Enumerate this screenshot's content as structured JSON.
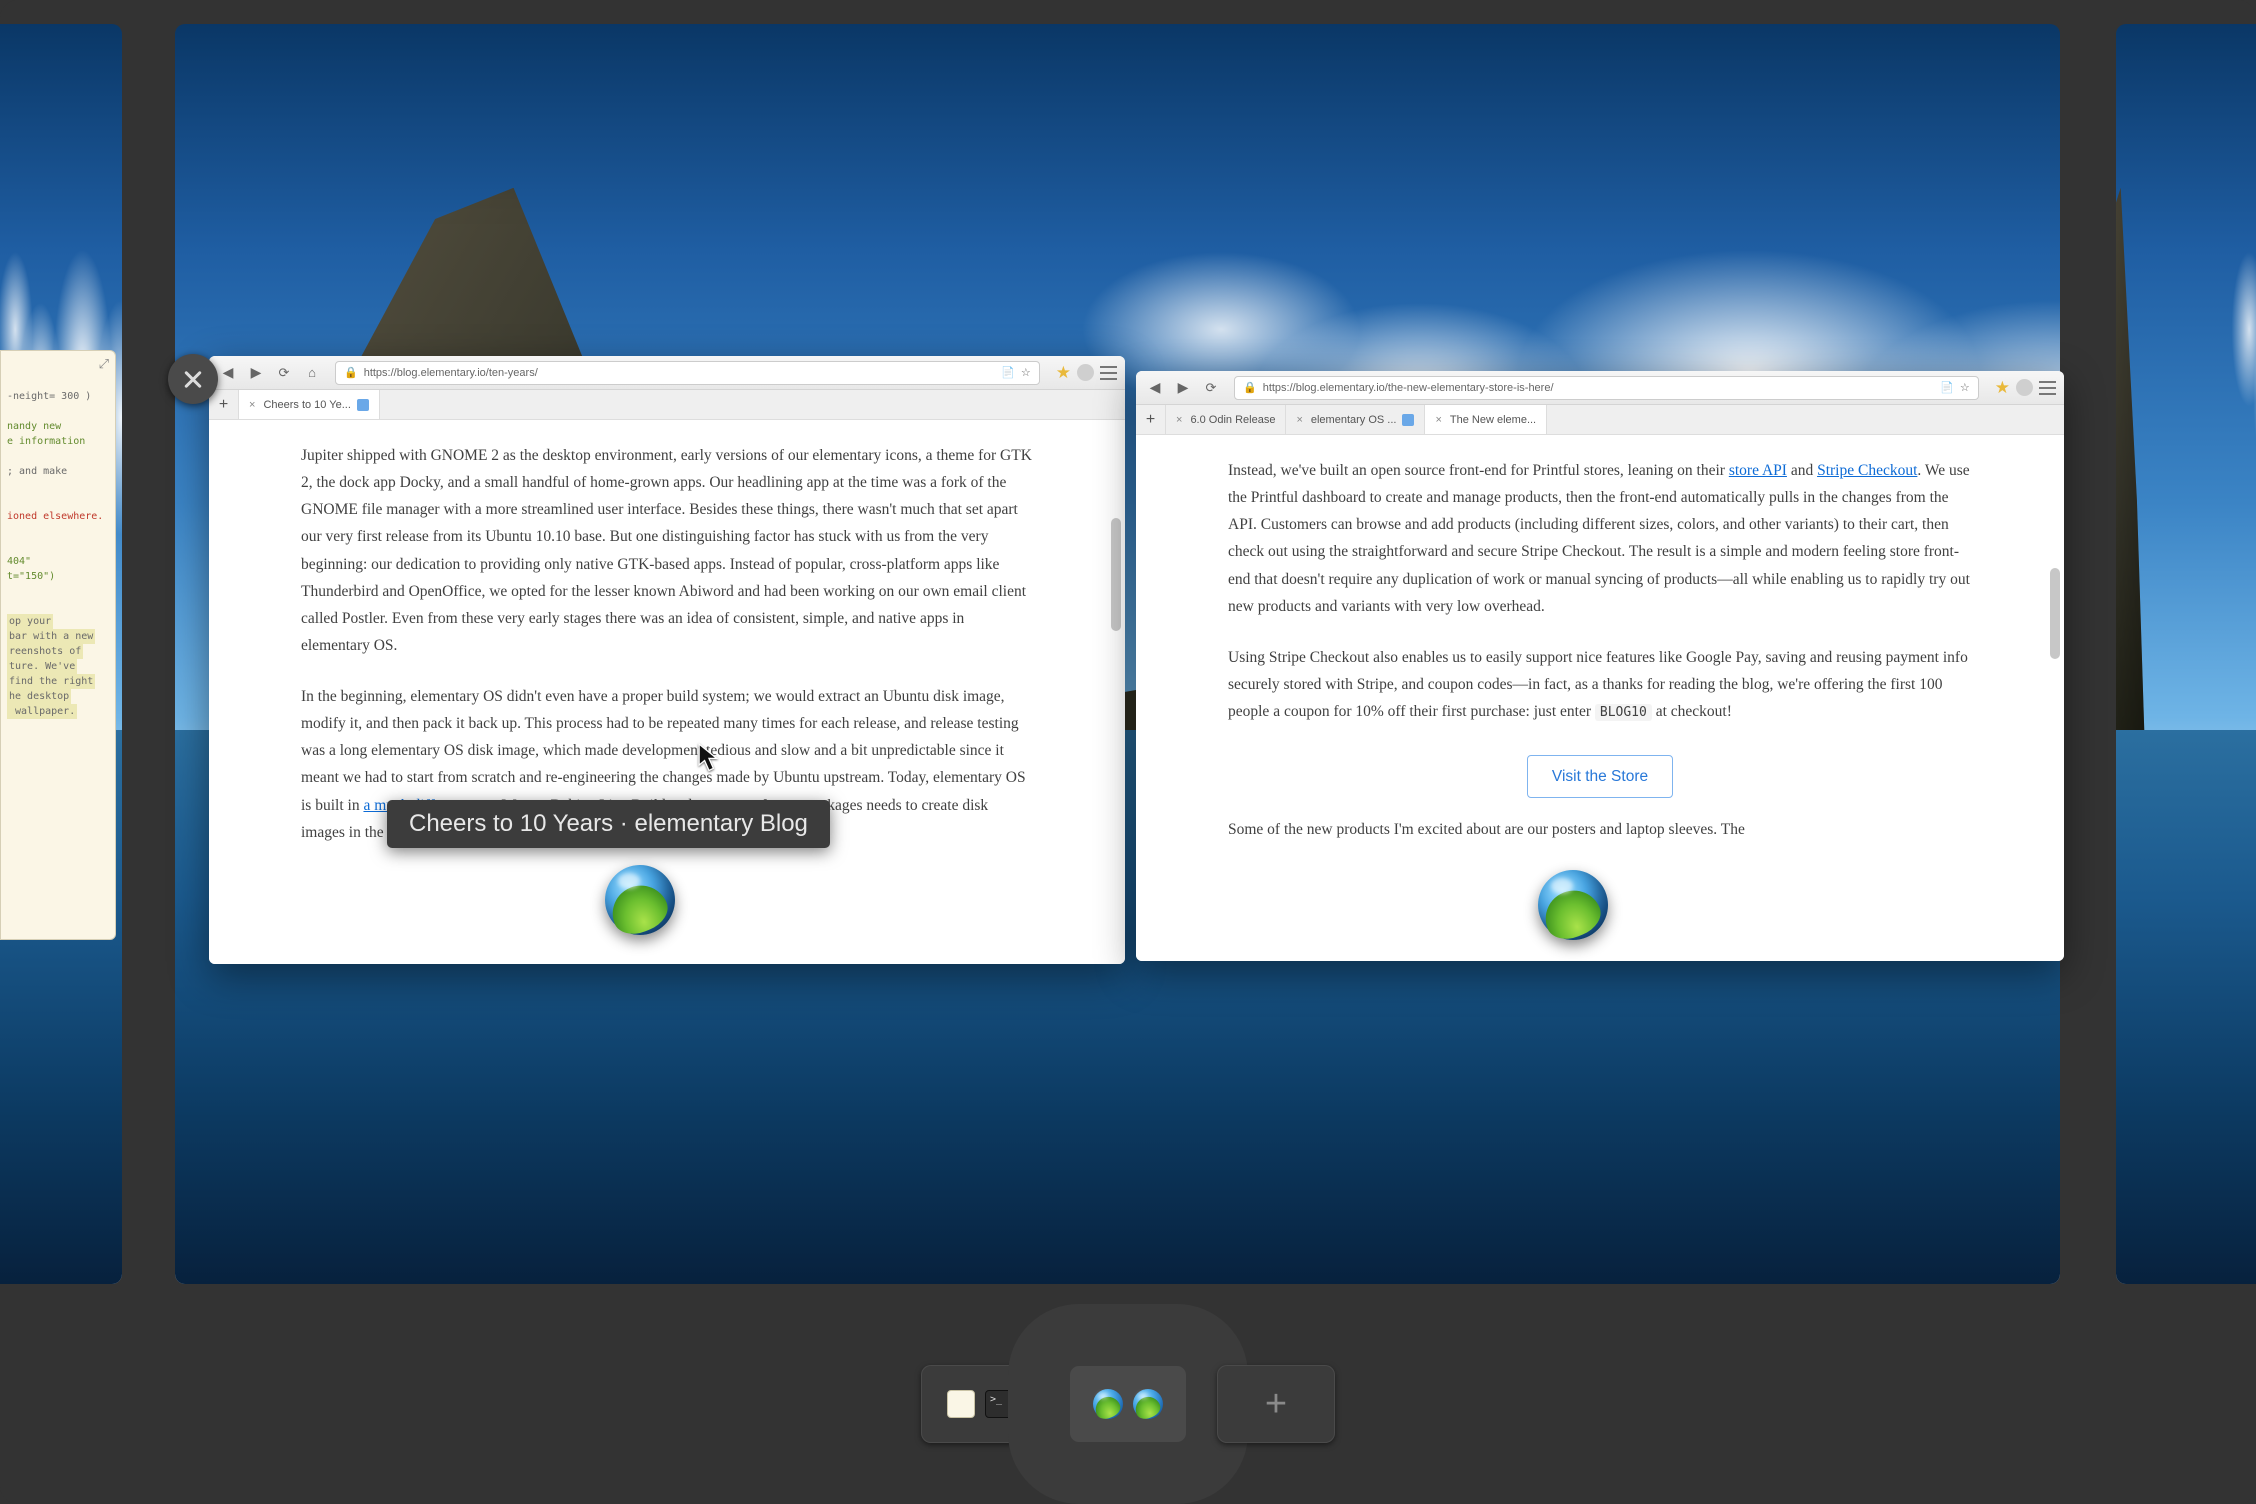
{
  "hover_title": "Cheers to 10 Years · elementary Blog",
  "peek_editor": {
    "lines": [
      "-neight= 300 )",
      "",
      "nandy new",
      "e information",
      "",
      "; and make",
      "",
      "",
      "ioned elsewhere.",
      "",
      "",
      "404\"",
      "t=\"150\")",
      "",
      "",
      "op your",
      "bar with a new",
      "reenshots of",
      "ture. We've",
      "find the right",
      "he desktop",
      " wallpaper."
    ]
  },
  "window1": {
    "url": "https://blog.elementary.io/ten-years/",
    "tab": {
      "title": "Cheers to 10 Ye..."
    },
    "p1": "Jupiter shipped with GNOME 2 as the desktop environment, early versions of our elementary icons, a theme for GTK 2, the dock app Docky, and a small handful of home-grown apps. Our headlining app at the time was a fork of the GNOME file manager with a more streamlined user interface. Besides these things, there wasn't much that set apart our very first release from its Ubuntu 10.10 base. But one distinguishing factor has stuck with us from the very beginning: our dedication to providing only native GTK-based apps. Instead of popular, cross-platform apps like Thunderbird and OpenOffice, we opted for the lesser known Abiword and had been working on our own email client called Postler. Even from these very early stages there was an idea of consistent, simple, and native apps in elementary OS.",
    "p2a": "In the beginning, elementary OS didn't even have a proper build system; we would extract an Ubuntu disk image, modify it, and then pack it back up. This process had to be repeated many times for each release, and release testing was a long elementary OS disk image, which made development tedious and slow and a bit unpredictable since it meant we had to start from scratch and re-engineering the changes made by Ubuntu upstream. Today, elementary OS is built in ",
    "p2link": "a much different way",
    "p2b": ". We use Debian Live Build and a system of meta-packages needs to create disk images in the"
  },
  "window2": {
    "url": "https://blog.elementary.io/the-new-elementary-store-is-here/",
    "tabs": [
      {
        "title": "6.0 Odin Release"
      },
      {
        "title": "elementary OS ..."
      },
      {
        "title": "The New eleme..."
      }
    ],
    "p1a": "Instead, we've built an open source front-end for Printful stores, leaning on their ",
    "p1link1": "store API",
    "p1mid": " and ",
    "p1link2": "Stripe Checkout",
    "p1b": ". We use the Printful dashboard to create and manage products, then the front-end automatically pulls in the changes from the API. Customers can browse and add products (including different sizes, colors, and other variants) to their cart, then check out using the straightforward and secure Stripe Checkout. The result is a simple and modern feeling store front-end that doesn't require any duplication of work or manual syncing of products—all while enabling us to rapidly try out new products and variants with very low overhead.",
    "p2a": "Using Stripe Checkout also enables us to easily support nice features like Google Pay, saving and reusing payment info securely stored with Stripe, and coupon codes—in fact, as a thanks for reading the blog, we're offering the first 100 people a coupon for 10% off their first purchase: just enter ",
    "p2code": "BLOG10",
    "p2b": " at checkout!",
    "button": "Visit the Store",
    "p3": "Some of the new products I'm excited about are our posters and laptop sleeves. The"
  },
  "switcher": {
    "tiles": [
      "code-terminal",
      "two-browsers",
      "add"
    ]
  },
  "icons": {
    "back": "‹",
    "fwd": "›",
    "reload": "⟳",
    "home": "⌂",
    "lock": "🔒",
    "reader": "📄",
    "bookmark": "☆",
    "star": "★",
    "add": "+",
    "close": "×",
    "max": "⤢"
  }
}
